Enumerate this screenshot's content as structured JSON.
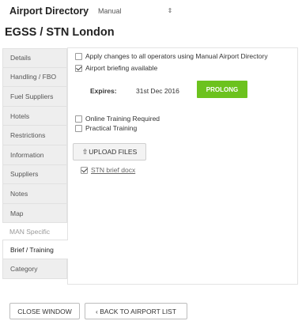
{
  "header": {
    "app_title": "Airport Directory",
    "directory_select_value": "Manual",
    "page_title": "EGSS / STN London"
  },
  "sidebar": {
    "items": [
      {
        "label": "Details"
      },
      {
        "label": "Handling / FBO"
      },
      {
        "label": "Fuel Suppliers"
      },
      {
        "label": "Hotels"
      },
      {
        "label": "Restrictions"
      },
      {
        "label": "Information"
      },
      {
        "label": "Suppliers"
      },
      {
        "label": "Notes"
      },
      {
        "label": "Map"
      }
    ],
    "section_label": "MAN Specific",
    "specific_items": [
      {
        "label": "Brief / Training",
        "active": true
      },
      {
        "label": "Category",
        "active": false
      }
    ]
  },
  "main": {
    "apply_changes": {
      "label": "Apply changes to all operators using Manual Airport Directory",
      "checked": false
    },
    "briefing_available": {
      "label": "Airport briefing available",
      "checked": true
    },
    "expires_label": "Expires:",
    "expires_date": "31st Dec 2016",
    "prolong_label": "PROLONG",
    "online_training": {
      "label": "Online Training Required",
      "checked": false
    },
    "practical_training": {
      "label": "Practical Training",
      "checked": false
    },
    "upload_label": "UPLOAD FILES",
    "file": {
      "name": "STN brief docx",
      "checked": true
    }
  },
  "footer": {
    "close_label": "CLOSE WINDOW",
    "back_label": "‹ BACK TO AIRPORT LIST"
  },
  "colors": {
    "prolong_green": "#6cc21e",
    "tab_inactive_bg": "#eeeeee"
  }
}
